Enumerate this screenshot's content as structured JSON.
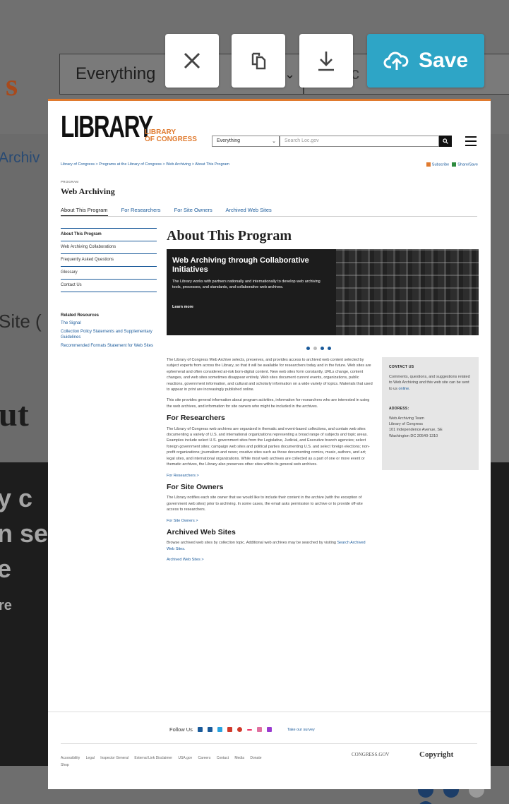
{
  "background": {
    "logo_fragment": "s",
    "select_value": "Everything",
    "search_fragment": "Sc",
    "breadcrumb_fragment": "Archiv",
    "site_fragment": "Site (",
    "about_fragment": "ut",
    "hero_lines": [
      "y c",
      "n se",
      "e",
      "re"
    ]
  },
  "toolbar": {
    "close_icon": "close-icon",
    "copy_icon": "copy-icon",
    "download_icon": "download-icon",
    "save_label": "Save",
    "save_color": "#2ea5c6"
  },
  "site": {
    "logo": "LIBRARY",
    "logo_sub1": "LIBRARY",
    "logo_sub2": "OF CONGRESS",
    "search_scope": "Everything",
    "search_placeholder": "Search Loc.gov",
    "breadcrumb": "Library of Congress > Programs at the Library of Congress > Web Archiving > About This Program",
    "subscribe": "Subscribe",
    "share": "Share/Save",
    "program_label": "PROGRAM",
    "program_title": "Web Archiving",
    "tabs": [
      "About This Program",
      "For Researchers",
      "For Site Owners",
      "Archived Web Sites"
    ],
    "sidebar": [
      "About This Program",
      "Web Archiving Collaborations",
      "Frequently Asked Questions",
      "Glossary",
      "Contact Us"
    ],
    "related_heading": "Related Resources",
    "related": [
      "The Signal",
      "Collection Policy Statements and Supplementary Guidelines",
      "Recommended Formats Statement for Web Sites"
    ],
    "page_heading": "About This Program",
    "hero_title": "Web Archiving through Collaborative Initiatives",
    "hero_desc": "The Library works with partners nationally and internationally to develop web archiving tools, processes, and standards, and collaborative web archives.",
    "hero_link": "Learn more",
    "intro1": "The Library of Congress Web Archive selects, preserves, and provides access to archived web content selected by subject experts from across the Library, so that it will be available for researchers today and in the future. Web sites are ephemeral and often considered at-risk born-digital content. New web sites form constantly, URLs change, content changes, and web sites sometimes disappear entirely. Web sites document current events, organizations, public reactions, government information, and cultural and scholarly information on a wide variety of topics. Materials that used to appear in print are increasingly published online.",
    "intro2": "This site provides general information about program activities, information for researchers who are interested in using the web archives, and information for site owners who might be included in the archives.",
    "researchers_heading": "For Researchers",
    "researchers_text": "The Library of Congress web archives are organized in thematic and event-based collections, and contain web sites documenting a variety of U.S. and international organizations representing a broad range of subjects and topic areas. Examples include select U.S. government sites from the Legislative, Judicial, and Executive branch agencies; select foreign government sites; campaign web sites and political parties documenting U.S. and select foreign elections; non-profit organizations; journalism and news; creative sites such as those documenting comics, music, authors, and art; legal sites, and international organizations. While most web archives are collected as a part of one or more event or thematic archives, the Library also preserves other sites within its general web archives.",
    "researchers_link": "For Researchers >",
    "owners_heading": "For Site Owners",
    "owners_text": "The Library notifies each site owner that we would like to include their content in the archive (with the exception of government web sites) prior to archiving. In some cases, the email asks permission to archive or to provide off-site access to researchers.",
    "owners_link": "For Site Owners >",
    "archived_heading": "Archived Web Sites",
    "archived_text_pre": "Browse archived web sites by collection topic. Additional web archives may be searched by visiting",
    "archived_text_link": "Search Archived Web Sites.",
    "archived_link": "Archived Web Sites >",
    "contact_heading": "CONTACT US",
    "contact_text": "Comments, questions, and suggestions related to Web Archiving and this web site can be sent to us",
    "contact_link": "online.",
    "address_heading": "ADDRESS:",
    "address": [
      "Web Archiving Team",
      "Library of Congress",
      "101 Independence Avenue, SE",
      "Washington DC 20540-1310"
    ],
    "follow_label": "Follow Us",
    "survey": "Take our survey",
    "footer_links": [
      "Accessibility",
      "Legal",
      "Inspector General",
      "External Link Disclaimer",
      "USA.gov",
      "Careers",
      "Contact",
      "Media",
      "Donate",
      "Shop"
    ],
    "congress_gov": "CONGRESS.GOV",
    "copyright": "Copyright"
  }
}
